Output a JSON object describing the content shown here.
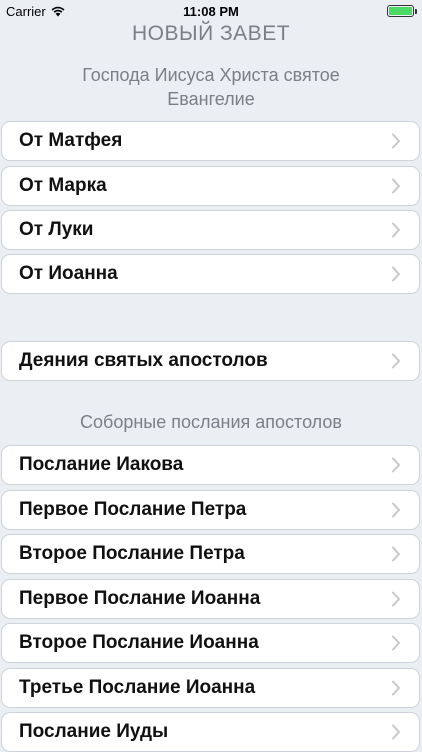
{
  "status_bar": {
    "carrier": "Carrier",
    "time": "11:08 PM"
  },
  "nav": {
    "title": "НОВЫЙ ЗАВЕТ"
  },
  "sections": {
    "gospels": {
      "header_line1": "Господа Иисуса Христа святое",
      "header_line2": "Евангелие",
      "items": [
        "От Матфея",
        "От Марка",
        "От Луки",
        "От Иоанна"
      ]
    },
    "acts": {
      "items": [
        "Деяния святых апостолов"
      ]
    },
    "epistles": {
      "header": "Соборные послания апостолов",
      "items": [
        "Послание Иакова",
        "Первое Послание Петра",
        "Второе Послание Петра",
        "Первое Послание Иоанна",
        "Второе Послание Иоанна",
        "Третье Послание Иоанна",
        "Послание Иуды"
      ]
    }
  },
  "colors": {
    "background": "#ebeef3",
    "header_text": "#7b7f88",
    "chevron": "#c7c7cc",
    "battery": "#4cd964"
  }
}
